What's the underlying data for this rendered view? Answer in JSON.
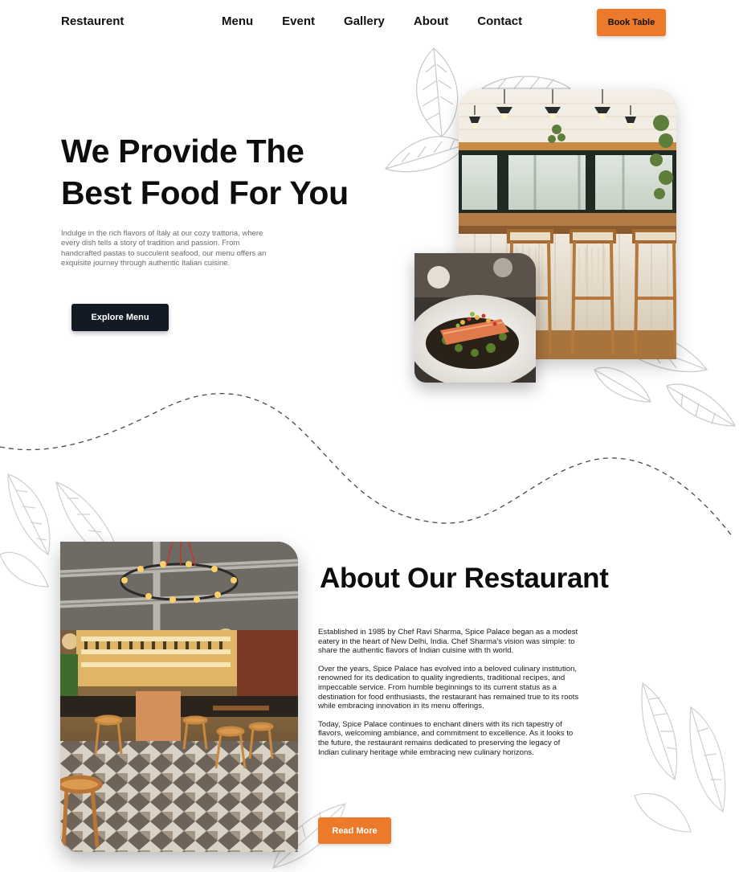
{
  "nav": {
    "brand": "Restaurent",
    "links": [
      "Menu",
      "Event",
      "Gallery",
      "About",
      "Contact"
    ],
    "book_label": "Book Table"
  },
  "hero": {
    "title_line1": "We Provide The",
    "title_line2": "Best Food For You",
    "description": "Indulge in the rich flavors of Italy at our cozy trattoria, where every dish tells a story of tradition and passion. From handcrafted pastas to succulent seafood, our menu offers an exquisite journey through authentic Italian cuisine.",
    "cta_label": "Explore Menu"
  },
  "about": {
    "title": "About Our Restaurant",
    "paragraphs": [
      "Established in 1985 by Chef Ravi Sharma, Spice Palace began as a modest eatery in the heart of New Delhi, India. Chef Sharma's vision was simple: to share the authentic flavors of Indian cuisine with th world.",
      "Over the years, Spice Palace has evolved into a beloved culinary institution, renowned for its dedication to quality ingredients, traditional recipes, and impeccable service. From humble beginnings to its current status as a destination for food enthusiasts, the restaurant has remained true to its roots while embracing innovation in its menu offerings.",
      "Today, Spice Palace continues to enchant diners with its rich tapestry of flavors, welcoming ambiance, and commitment to excellence. As it looks to the future, the restaurant remains dedicated to preserving the legacy of Indian culinary heritage while embracing new culinary horizons."
    ],
    "cta_label": "Read More"
  },
  "colors": {
    "accent": "#ec7a2b",
    "dark_button": "#121a26",
    "text": "#0d0d0d"
  },
  "icons": [
    "leaf-decoration-icon"
  ]
}
